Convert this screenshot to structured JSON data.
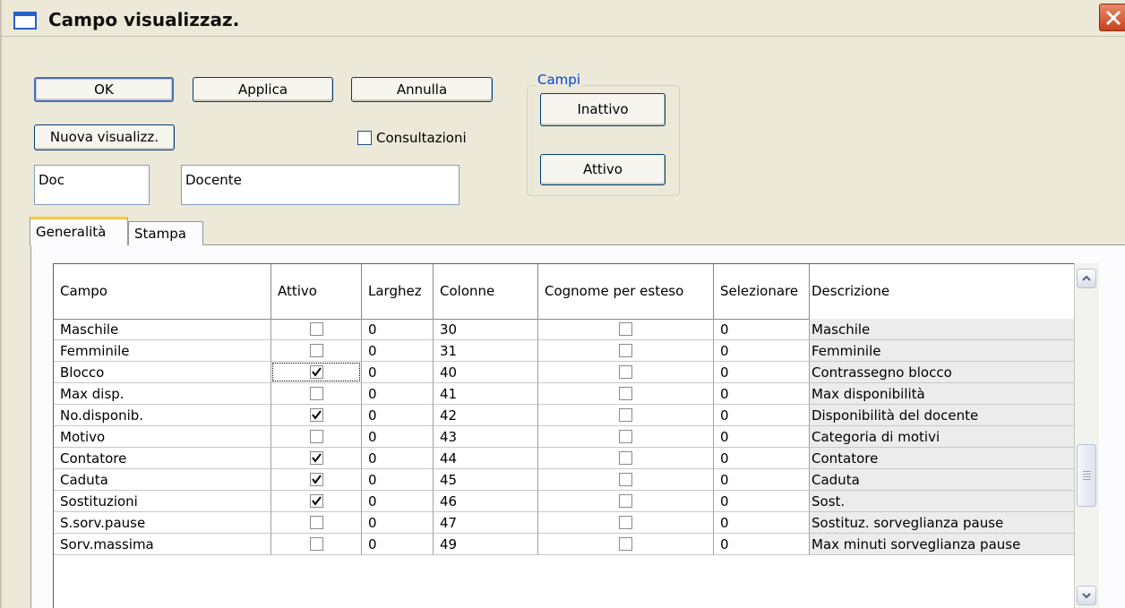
{
  "window": {
    "title": "Campo visualizzaz."
  },
  "buttons": {
    "ok": "OK",
    "apply": "Applica",
    "cancel": "Annulla",
    "new_view": "Nuova visualizz.",
    "inactive": "Inattivo",
    "active": "Attivo"
  },
  "consultazioni": {
    "label": "Consultazioni",
    "checked": false
  },
  "fields": {
    "short_name": "Doc",
    "long_name": "Docente"
  },
  "group": {
    "title": "Campi"
  },
  "tabs": [
    {
      "label": "Generalità",
      "active": true
    },
    {
      "label": "Stampa",
      "active": false
    }
  ],
  "grid": {
    "columns": [
      "Campo",
      "Attivo",
      "Larghez",
      "Colonne",
      "Cognome per esteso",
      "Selezionare",
      "Descrizione"
    ],
    "rows": [
      {
        "campo": "Maschile",
        "attivo": false,
        "larghezza": "0",
        "colonne": "30",
        "cognome": false,
        "selezionare": "0",
        "descrizione": "Maschile"
      },
      {
        "campo": "Femminile",
        "attivo": false,
        "larghezza": "0",
        "colonne": "31",
        "cognome": false,
        "selezionare": "0",
        "descrizione": "Femminile"
      },
      {
        "campo": "Blocco",
        "attivo": true,
        "larghezza": "0",
        "colonne": "40",
        "cognome": false,
        "selezionare": "0",
        "descrizione": "Contrassegno blocco",
        "focused": true
      },
      {
        "campo": "Max disp.",
        "attivo": false,
        "larghezza": "0",
        "colonne": "41",
        "cognome": false,
        "selezionare": "0",
        "descrizione": "Max disponibilità"
      },
      {
        "campo": "No.disponib.",
        "attivo": true,
        "larghezza": "0",
        "colonne": "42",
        "cognome": false,
        "selezionare": "0",
        "descrizione": "Disponibilità del docente"
      },
      {
        "campo": "Motivo",
        "attivo": false,
        "larghezza": "0",
        "colonne": "43",
        "cognome": false,
        "selezionare": "0",
        "descrizione": "Categoria di motivi"
      },
      {
        "campo": "Contatore",
        "attivo": true,
        "larghezza": "0",
        "colonne": "44",
        "cognome": false,
        "selezionare": "0",
        "descrizione": "Contatore"
      },
      {
        "campo": "Caduta",
        "attivo": true,
        "larghezza": "0",
        "colonne": "45",
        "cognome": false,
        "selezionare": "0",
        "descrizione": "Caduta"
      },
      {
        "campo": "Sostituzioni",
        "attivo": true,
        "larghezza": "0",
        "colonne": "46",
        "cognome": false,
        "selezionare": "0",
        "descrizione": "Sost."
      },
      {
        "campo": "S.sorv.pause",
        "attivo": false,
        "larghezza": "0",
        "colonne": "47",
        "cognome": false,
        "selezionare": "0",
        "descrizione": "Sostituz. sorveglianza pause"
      },
      {
        "campo": "Sorv.massima",
        "attivo": false,
        "larghezza": "0",
        "colonne": "49",
        "cognome": false,
        "selezionare": "0",
        "descrizione": "Max minuti sorveglianza pause"
      }
    ]
  },
  "colors": {
    "accent": "#0046d5",
    "tab_highlight": "#ffc83c",
    "close": "#c8411e"
  }
}
